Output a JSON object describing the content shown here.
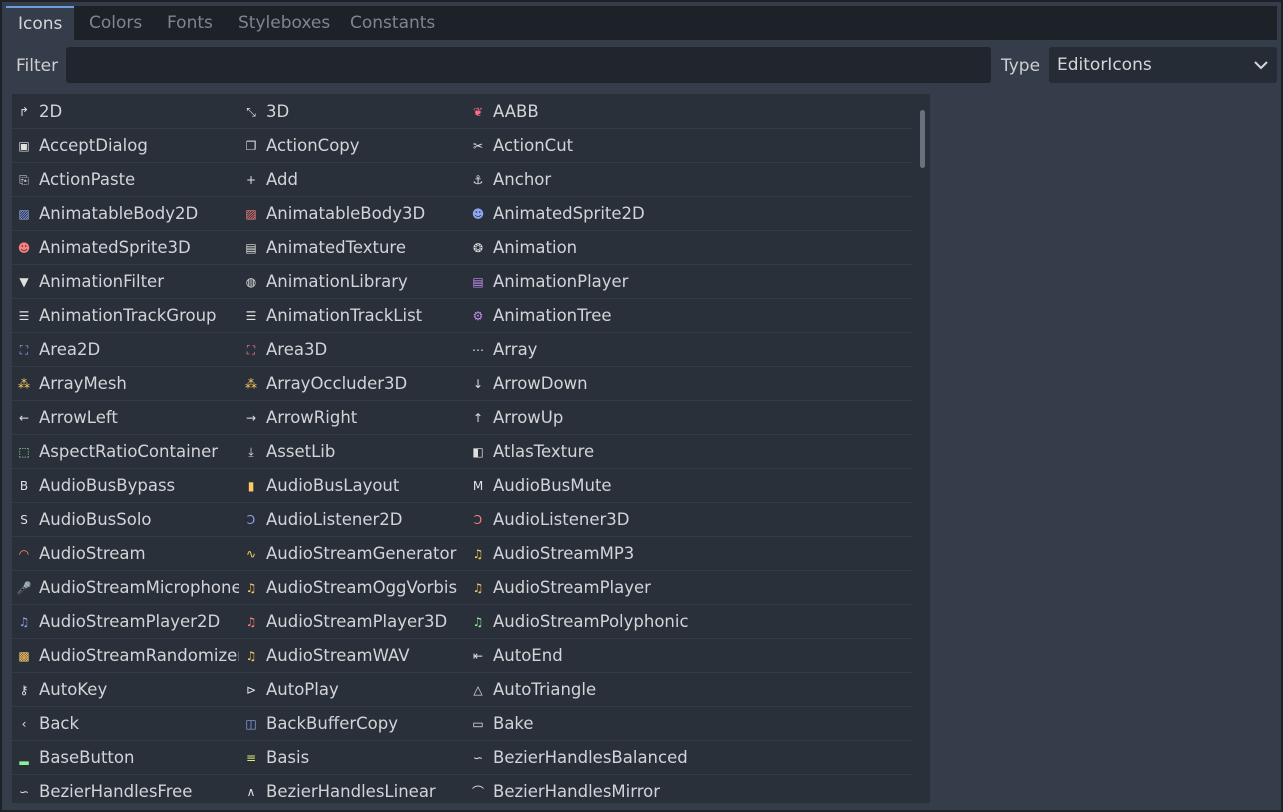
{
  "tabs": [
    {
      "label": "Icons",
      "active": true
    },
    {
      "label": "Colors",
      "active": false
    },
    {
      "label": "Fonts",
      "active": false
    },
    {
      "label": "Styleboxes",
      "active": false
    },
    {
      "label": "Constants",
      "active": false
    }
  ],
  "filter": {
    "label": "Filter",
    "value": "",
    "placeholder": ""
  },
  "type_selector": {
    "label": "Type",
    "selected": "EditorIcons"
  },
  "items": [
    [
      {
        "name": "2D",
        "icon": "node2d-icon",
        "color": "#e0e0e0"
      },
      {
        "name": "3D",
        "icon": "node3d-icon",
        "color": "#e0e0e0"
      },
      {
        "name": "AABB",
        "icon": "aabb-icon",
        "color": "#ff6b8a"
      }
    ],
    [
      {
        "name": "AcceptDialog",
        "icon": "dialog-icon",
        "color": "#e0e0e0"
      },
      {
        "name": "ActionCopy",
        "icon": "copy-icon",
        "color": "#e0e0e0"
      },
      {
        "name": "ActionCut",
        "icon": "scissors-icon",
        "color": "#e0e0e0"
      }
    ],
    [
      {
        "name": "ActionPaste",
        "icon": "clipboard-icon",
        "color": "#e0e0e0"
      },
      {
        "name": "Add",
        "icon": "plus-icon",
        "color": "#e0e0e0"
      },
      {
        "name": "Anchor",
        "icon": "anchor-icon",
        "color": "#e0e0e0"
      }
    ],
    [
      {
        "name": "AnimatableBody2D",
        "icon": "body2d-icon",
        "color": "#8da5f3"
      },
      {
        "name": "AnimatableBody3D",
        "icon": "body3d-icon",
        "color": "#fc7f7f"
      },
      {
        "name": "AnimatedSprite2D",
        "icon": "sprite2d-icon",
        "color": "#8da5f3"
      }
    ],
    [
      {
        "name": "AnimatedSprite3D",
        "icon": "sprite3d-icon",
        "color": "#fc7f7f"
      },
      {
        "name": "AnimatedTexture",
        "icon": "film-icon",
        "color": "#e0e0e0"
      },
      {
        "name": "Animation",
        "icon": "animation-icon",
        "color": "#e0e0e0"
      }
    ],
    [
      {
        "name": "AnimationFilter",
        "icon": "filter-icon",
        "color": "#e0e0e0"
      },
      {
        "name": "AnimationLibrary",
        "icon": "library-icon",
        "color": "#e0e0e0"
      },
      {
        "name": "AnimationPlayer",
        "icon": "player-icon",
        "color": "#c38ef1"
      }
    ],
    [
      {
        "name": "AnimationTrackGroup",
        "icon": "track-group-icon",
        "color": "#e0e0e0"
      },
      {
        "name": "AnimationTrackList",
        "icon": "list-icon",
        "color": "#e0e0e0"
      },
      {
        "name": "AnimationTree",
        "icon": "tree-icon",
        "color": "#c38ef1"
      }
    ],
    [
      {
        "name": "Area2D",
        "icon": "area2d-icon",
        "color": "#8da5f3"
      },
      {
        "name": "Area3D",
        "icon": "area3d-icon",
        "color": "#fc7f7f"
      },
      {
        "name": "Array",
        "icon": "array-icon",
        "color": "#e0e0e0"
      }
    ],
    [
      {
        "name": "ArrayMesh",
        "icon": "mesh-icon",
        "color": "#ffca5f"
      },
      {
        "name": "ArrayOccluder3D",
        "icon": "occluder-icon",
        "color": "#ffca5f"
      },
      {
        "name": "ArrowDown",
        "icon": "arrow-down-icon",
        "color": "#e0e0e0"
      }
    ],
    [
      {
        "name": "ArrowLeft",
        "icon": "arrow-left-icon",
        "color": "#e0e0e0"
      },
      {
        "name": "ArrowRight",
        "icon": "arrow-right-icon",
        "color": "#e0e0e0"
      },
      {
        "name": "ArrowUp",
        "icon": "arrow-up-icon",
        "color": "#e0e0e0"
      }
    ],
    [
      {
        "name": "AspectRatioContainer",
        "icon": "container-icon",
        "color": "#8eef97"
      },
      {
        "name": "AssetLib",
        "icon": "download-icon",
        "color": "#e0e0e0"
      },
      {
        "name": "AtlasTexture",
        "icon": "atlas-icon",
        "color": "#e0e0e0"
      }
    ],
    [
      {
        "name": "AudioBusBypass",
        "icon": "bypass-icon",
        "color": "#e0e0e0"
      },
      {
        "name": "AudioBusLayout",
        "icon": "bus-layout-icon",
        "color": "#ffca5f"
      },
      {
        "name": "AudioBusMute",
        "icon": "mute-icon",
        "color": "#e0e0e0"
      }
    ],
    [
      {
        "name": "AudioBusSolo",
        "icon": "solo-icon",
        "color": "#e0e0e0"
      },
      {
        "name": "AudioListener2D",
        "icon": "ear2d-icon",
        "color": "#8da5f3"
      },
      {
        "name": "AudioListener3D",
        "icon": "ear3d-icon",
        "color": "#fc7f7f"
      }
    ],
    [
      {
        "name": "AudioStream",
        "icon": "stream-icon",
        "color": "#ff8c5a"
      },
      {
        "name": "AudioStreamGenerator",
        "icon": "wave-icon",
        "color": "#ffca5f"
      },
      {
        "name": "AudioStreamMP3",
        "icon": "music-note-icon",
        "color": "#ffca5f"
      }
    ],
    [
      {
        "name": "AudioStreamMicrophone",
        "icon": "microphone-icon",
        "color": "#ffca5f"
      },
      {
        "name": "AudioStreamOggVorbis",
        "icon": "music-note-icon",
        "color": "#ffca5f"
      },
      {
        "name": "AudioStreamPlayer",
        "icon": "music-note-icon",
        "color": "#ffca5f"
      }
    ],
    [
      {
        "name": "AudioStreamPlayer2D",
        "icon": "music-note-icon",
        "color": "#8da5f3"
      },
      {
        "name": "AudioStreamPlayer3D",
        "icon": "music-note-icon",
        "color": "#fc7f7f"
      },
      {
        "name": "AudioStreamPolyphonic",
        "icon": "music-note-icon",
        "color": "#8eef97"
      }
    ],
    [
      {
        "name": "AudioStreamRandomizer",
        "icon": "randomizer-icon",
        "color": "#ffca5f"
      },
      {
        "name": "AudioStreamWAV",
        "icon": "music-note-icon",
        "color": "#ffca5f"
      },
      {
        "name": "AutoEnd",
        "icon": "auto-end-icon",
        "color": "#e0e0e0"
      }
    ],
    [
      {
        "name": "AutoKey",
        "icon": "key-icon",
        "color": "#e0e0e0"
      },
      {
        "name": "AutoPlay",
        "icon": "autoplay-icon",
        "color": "#e0e0e0"
      },
      {
        "name": "AutoTriangle",
        "icon": "triangle-icon",
        "color": "#e0e0e0"
      }
    ],
    [
      {
        "name": "Back",
        "icon": "back-icon",
        "color": "#e0e0e0"
      },
      {
        "name": "BackBufferCopy",
        "icon": "buffer-copy-icon",
        "color": "#8da5f3"
      },
      {
        "name": "Bake",
        "icon": "bake-icon",
        "color": "#e0e0e0"
      }
    ],
    [
      {
        "name": "BaseButton",
        "icon": "button-icon",
        "color": "#8eef97"
      },
      {
        "name": "Basis",
        "icon": "basis-icon",
        "color": "#e3ec69"
      },
      {
        "name": "BezierHandlesBalanced",
        "icon": "bezier-icon",
        "color": "#e0e0e0"
      }
    ],
    [
      {
        "name": "BezierHandlesFree",
        "icon": "bezier-icon",
        "color": "#e0e0e0"
      },
      {
        "name": "BezierHandlesLinear",
        "icon": "bezier-linear-icon",
        "color": "#e0e0e0"
      },
      {
        "name": "BezierHandlesMirror",
        "icon": "bezier-mirror-icon",
        "color": "#e0e0e0"
      }
    ]
  ],
  "glyphs": {
    "node2d-icon": "↱",
    "node3d-icon": "⤡",
    "aabb-icon": "❦",
    "dialog-icon": "▣",
    "copy-icon": "❐",
    "scissors-icon": "✂",
    "clipboard-icon": "⎘",
    "plus-icon": "+",
    "anchor-icon": "⚓",
    "body2d-icon": "▨",
    "body3d-icon": "▨",
    "sprite2d-icon": "☻",
    "sprite3d-icon": "☻",
    "film-icon": "▤",
    "animation-icon": "❂",
    "filter-icon": "▼",
    "library-icon": "◍",
    "player-icon": "▤",
    "track-group-icon": "☰",
    "list-icon": "☰",
    "tree-icon": "⚙",
    "area2d-icon": "⛶",
    "area3d-icon": "⛶",
    "array-icon": "⋯",
    "mesh-icon": "⁂",
    "occluder-icon": "⁂",
    "arrow-down-icon": "↓",
    "arrow-left-icon": "←",
    "arrow-right-icon": "→",
    "arrow-up-icon": "↑",
    "container-icon": "⬚",
    "download-icon": "⤓",
    "atlas-icon": "◧",
    "bypass-icon": "B",
    "bus-layout-icon": "▮",
    "mute-icon": "M",
    "solo-icon": "S",
    "ear2d-icon": "Ↄ",
    "ear3d-icon": "Ↄ",
    "stream-icon": "◠",
    "wave-icon": "∿",
    "music-note-icon": "♫",
    "microphone-icon": "🎤",
    "randomizer-icon": "▩",
    "auto-end-icon": "⇤",
    "key-icon": "⚷",
    "autoplay-icon": "⊳",
    "triangle-icon": "△",
    "back-icon": "‹",
    "buffer-copy-icon": "◫",
    "bake-icon": "▭",
    "button-icon": "▂",
    "basis-icon": "≡",
    "bezier-icon": "∽",
    "bezier-linear-icon": "∧",
    "bezier-mirror-icon": "⌒"
  },
  "colors": {
    "accent": "#6c9fe0",
    "panel_bg": "#363d4a",
    "list_bg": "#2a303a"
  }
}
